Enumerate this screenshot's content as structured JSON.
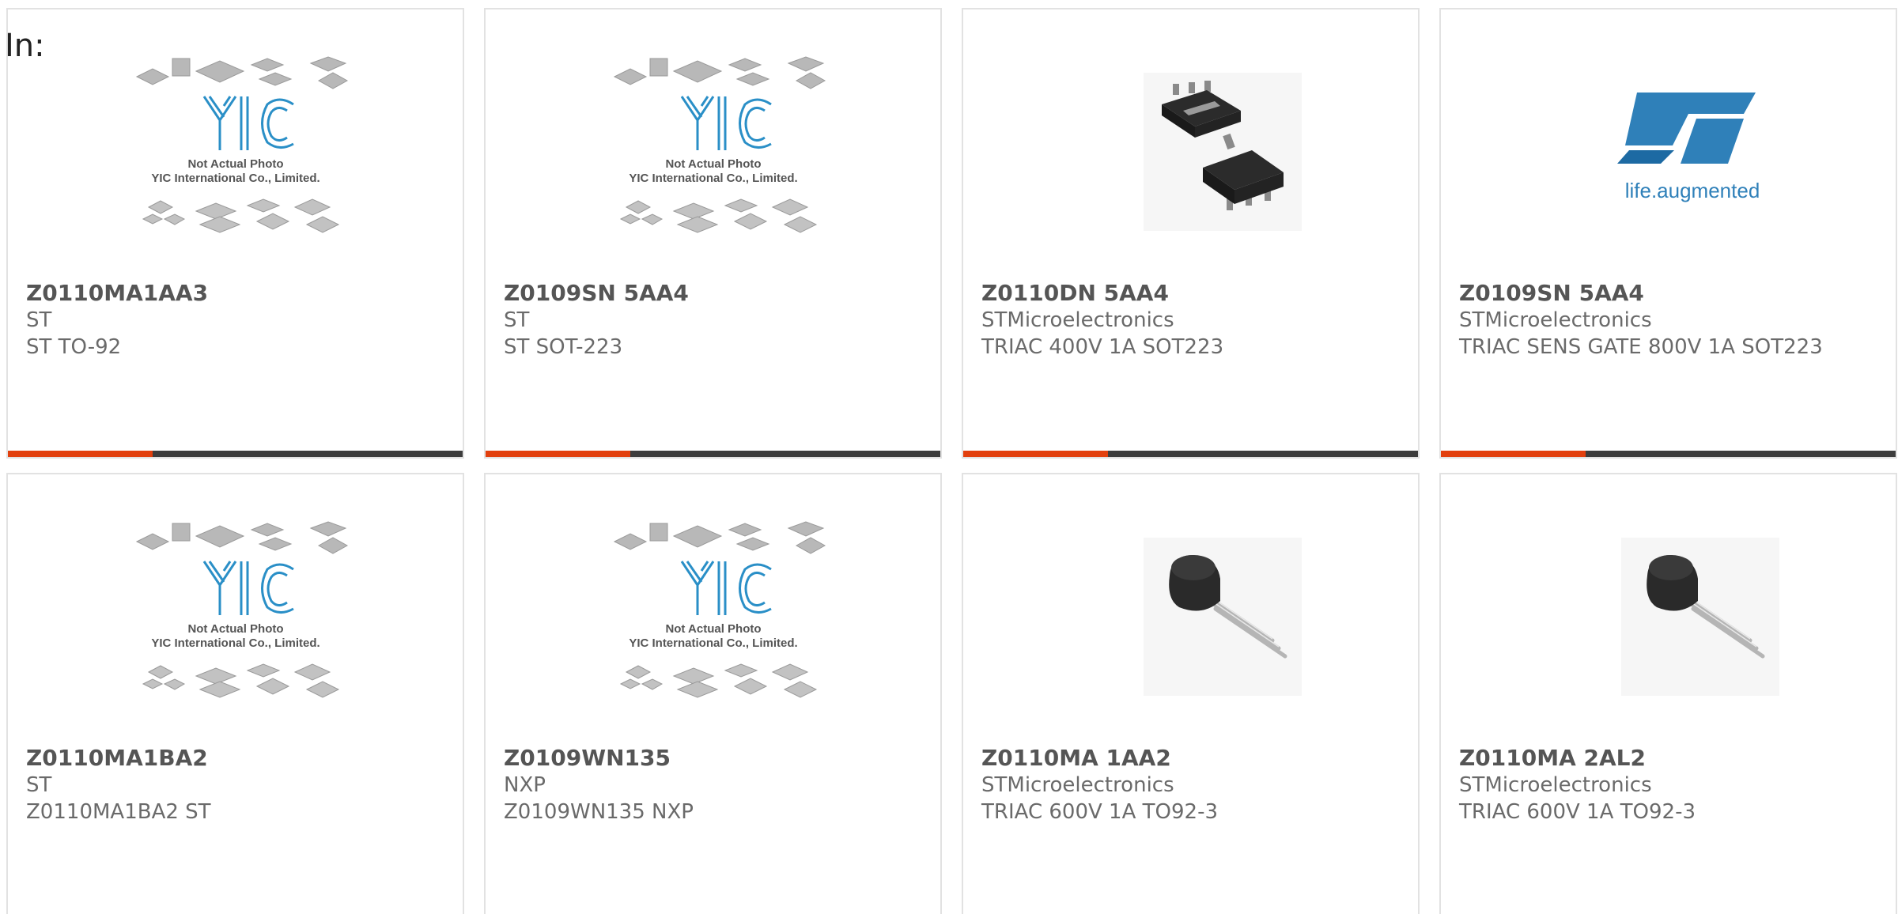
{
  "page": {
    "in_label": "In:"
  },
  "yic_placeholder": {
    "line1": "Not Actual Photo",
    "line2": "YIC International Co., Limited."
  },
  "st_logo": {
    "tagline": "life.augmented"
  },
  "colors": {
    "accent": "#e2400e",
    "bar": "#3d3d3d",
    "border": "#e2e2e2",
    "yic_blue": "#2a8fc7",
    "st_blue": "#2f80b9"
  },
  "cards": [
    {
      "part": "Z0110MA1AA3",
      "manufacturer": "ST",
      "description": "ST TO-92",
      "image": "yic-placeholder"
    },
    {
      "part": "Z0109SN 5AA4",
      "manufacturer": "ST",
      "description": "ST SOT-223",
      "image": "yic-placeholder"
    },
    {
      "part": "Z0110DN 5AA4",
      "manufacturer": "STMicroelectronics",
      "description": "TRIAC 400V 1A SOT223",
      "image": "sot223-package"
    },
    {
      "part": "Z0109SN 5AA4",
      "manufacturer": "STMicroelectronics",
      "description": "TRIAC SENS GATE 800V 1A SOT223",
      "image": "st-logo"
    },
    {
      "part": "Z0110MA1BA2",
      "manufacturer": "ST",
      "description": "Z0110MA1BA2 ST",
      "image": "yic-placeholder"
    },
    {
      "part": "Z0109WN135",
      "manufacturer": "NXP",
      "description": "Z0109WN135 NXP",
      "image": "yic-placeholder"
    },
    {
      "part": "Z0110MA 1AA2",
      "manufacturer": "STMicroelectronics",
      "description": "TRIAC 600V 1A TO92-3",
      "image": "to92-package"
    },
    {
      "part": "Z0110MA 2AL2",
      "manufacturer": "STMicroelectronics",
      "description": "TRIAC 600V 1A TO92-3",
      "image": "to92-package"
    }
  ]
}
